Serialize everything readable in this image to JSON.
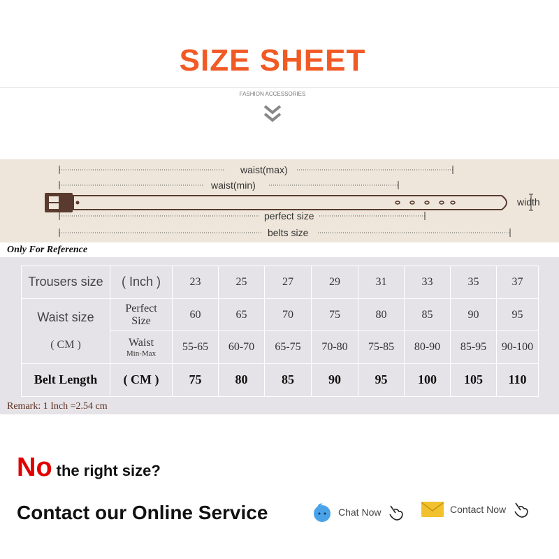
{
  "header": {
    "title": "SIZE SHEET",
    "subtitle": "FASHION ACCESSORIES",
    "chevron_icon": "double-chevron-down-icon"
  },
  "diagram": {
    "waist_max": "waist(max)",
    "waist_min": "waist(min)",
    "perfect_size": "perfect size",
    "belts_size": "belts size",
    "width": "width"
  },
  "note": "Only For Reference",
  "table": {
    "row1": {
      "label": "Trousers size",
      "unit": "( Inch )",
      "values": [
        "23",
        "25",
        "27",
        "29",
        "31",
        "33",
        "35",
        "37"
      ]
    },
    "waist_label": "Waist size",
    "waist_unit": "( CM )",
    "row2": {
      "label_a": "Perfect",
      "label_b": "Size",
      "values": [
        "60",
        "65",
        "70",
        "75",
        "80",
        "85",
        "90",
        "95"
      ]
    },
    "row3": {
      "label_a": "Waist",
      "label_b": "Min-Max",
      "values": [
        "55-65",
        "60-70",
        "65-75",
        "70-80",
        "75-85",
        "80-90",
        "85-95",
        "90-100"
      ]
    },
    "row4": {
      "label": "Belt Length",
      "unit": "( CM )",
      "values": [
        "75",
        "80",
        "85",
        "90",
        "95",
        "100",
        "105",
        "110"
      ]
    }
  },
  "remark": "Remark: 1 Inch =2.54 cm",
  "footer": {
    "no": "No",
    "question": "the right size?",
    "contact": "Contact our Online Service",
    "chat_label": "Chat Now",
    "contact_label": "Contact Now"
  },
  "colors": {
    "title": "#f15a24",
    "band": "#eee6da",
    "panel": "#e5e3e7",
    "no": "#e00000",
    "belt": "#5a3a2e"
  }
}
